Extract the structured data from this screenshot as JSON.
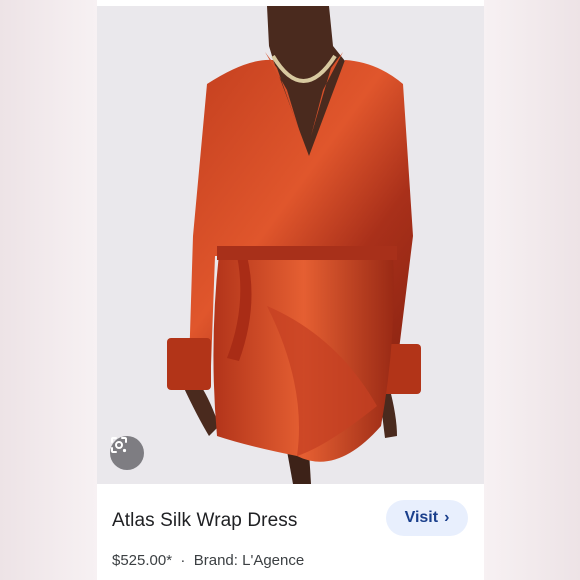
{
  "product": {
    "title": "Atlas Silk Wrap Dress",
    "price": "$525.00*",
    "separator": "·",
    "brand": "Brand: L'Agence"
  },
  "actions": {
    "visit_label": "Visit",
    "visit_chevron": "›"
  },
  "icons": {
    "lens": "google-lens-icon"
  },
  "colors": {
    "dress": "#b8341a",
    "visit_bg": "#e8effd",
    "visit_text": "#1a3f8c"
  }
}
